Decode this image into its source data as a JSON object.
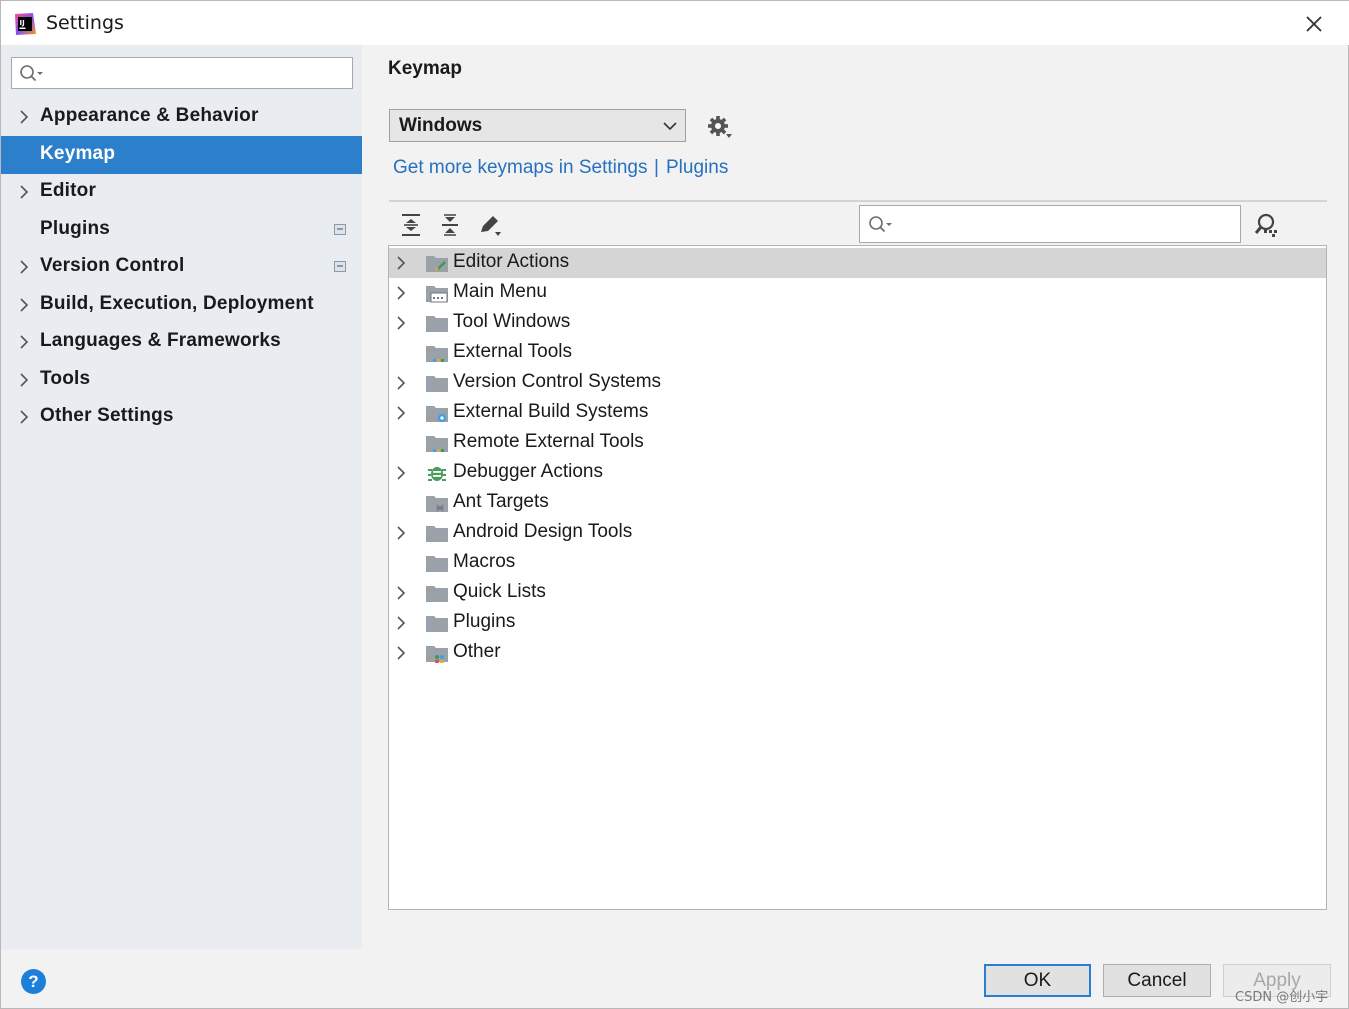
{
  "window": {
    "title": "Settings"
  },
  "sidebar": {
    "search": {
      "value": "",
      "placeholder": ""
    },
    "items": [
      {
        "label": "Appearance & Behavior",
        "expandable": true,
        "selected": false,
        "project_badge": false
      },
      {
        "label": "Keymap",
        "expandable": false,
        "selected": true,
        "project_badge": false
      },
      {
        "label": "Editor",
        "expandable": true,
        "selected": false,
        "project_badge": false
      },
      {
        "label": "Plugins",
        "expandable": false,
        "selected": false,
        "project_badge": true
      },
      {
        "label": "Version Control",
        "expandable": true,
        "selected": false,
        "project_badge": true
      },
      {
        "label": "Build, Execution, Deployment",
        "expandable": true,
        "selected": false,
        "project_badge": false
      },
      {
        "label": "Languages & Frameworks",
        "expandable": true,
        "selected": false,
        "project_badge": false
      },
      {
        "label": "Tools",
        "expandable": true,
        "selected": false,
        "project_badge": false
      },
      {
        "label": "Other Settings",
        "expandable": true,
        "selected": false,
        "project_badge": false
      }
    ]
  },
  "content": {
    "title": "Keymap",
    "keymap_select": {
      "value": "Windows"
    },
    "links": {
      "settings": "Get more keymaps in Settings",
      "separator": "|",
      "plugins": "Plugins"
    },
    "tree_search": {
      "value": "",
      "placeholder": ""
    },
    "tree": [
      {
        "label": "Editor Actions",
        "expandable": true,
        "icon": "editor-actions-folder-icon",
        "selected": true
      },
      {
        "label": "Main Menu",
        "expandable": true,
        "icon": "main-menu-folder-icon",
        "selected": false
      },
      {
        "label": "Tool Windows",
        "expandable": true,
        "icon": "folder-icon",
        "selected": false
      },
      {
        "label": "External Tools",
        "expandable": false,
        "icon": "external-tools-folder-icon",
        "selected": false
      },
      {
        "label": "Version Control Systems",
        "expandable": true,
        "icon": "folder-icon",
        "selected": false
      },
      {
        "label": "External Build Systems",
        "expandable": true,
        "icon": "build-systems-folder-icon",
        "selected": false
      },
      {
        "label": "Remote External Tools",
        "expandable": false,
        "icon": "external-tools-folder-icon",
        "selected": false
      },
      {
        "label": "Debugger Actions",
        "expandable": true,
        "icon": "debugger-bug-icon",
        "selected": false
      },
      {
        "label": "Ant Targets",
        "expandable": false,
        "icon": "ant-folder-icon",
        "selected": false
      },
      {
        "label": "Android Design Tools",
        "expandable": true,
        "icon": "folder-icon",
        "selected": false
      },
      {
        "label": "Macros",
        "expandable": false,
        "icon": "folder-icon",
        "selected": false
      },
      {
        "label": "Quick Lists",
        "expandable": true,
        "icon": "folder-icon",
        "selected": false
      },
      {
        "label": "Plugins",
        "expandable": true,
        "icon": "folder-icon",
        "selected": false
      },
      {
        "label": "Other",
        "expandable": true,
        "icon": "other-folder-icon",
        "selected": false
      }
    ]
  },
  "footer": {
    "help": "?",
    "ok": "OK",
    "cancel": "Cancel",
    "apply": "Apply",
    "watermark": "CSDN @创小宇"
  },
  "colors": {
    "accent": "#2b7fcb",
    "link": "#2770c0",
    "sidebar_bg": "#e9edf2",
    "selection_row": "#d5d5d5",
    "help": "#1e7fdb"
  }
}
